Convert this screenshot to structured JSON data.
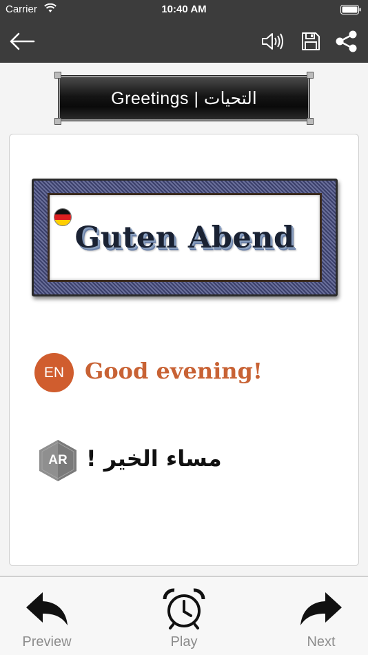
{
  "status": {
    "carrier": "Carrier",
    "time": "10:40 AM"
  },
  "nav": {
    "icons": [
      "back-arrow-icon",
      "speaker-icon",
      "save-icon",
      "share-icon"
    ]
  },
  "header": {
    "title": "Greetings | التحيات"
  },
  "phrase": {
    "german": {
      "text": "Guten Abend",
      "flag": "germany-flag"
    },
    "english": {
      "badge": "EN",
      "text": "Good evening!"
    },
    "arabic": {
      "badge": "AR",
      "text": "مساء الخير !"
    }
  },
  "toolbar": {
    "preview_label": "Preview",
    "play_label": "Play",
    "next_label": "Next"
  },
  "colors": {
    "bar": "#3c3c3c",
    "en_accent": "#d05d2e",
    "ar_badge": "#8a8a8a",
    "toolbar_text": "#8c8c8c"
  }
}
